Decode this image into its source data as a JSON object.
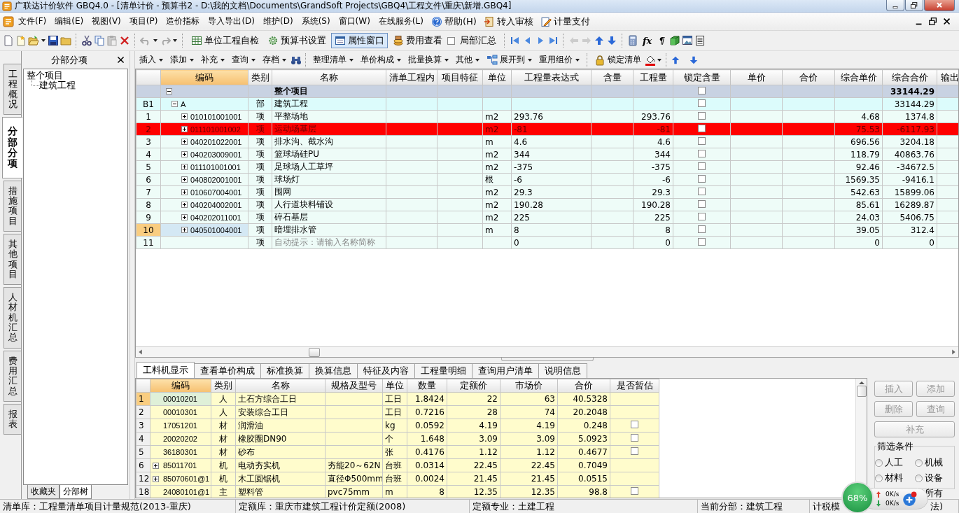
{
  "title_bar": {
    "title": "广联达计价软件 GBQ4.0 - [清单计价 - 预算书2 - D:\\我的文档\\Documents\\GrandSoft Projects\\GBQ4\\工程文件\\重庆\\新增.GBQ4]"
  },
  "menu_bar": {
    "menus": [
      "文件(F)",
      "编辑(E)",
      "视图(V)",
      "项目(P)",
      "造价指标",
      "导入导出(D)",
      "维护(D)",
      "系统(S)",
      "窗口(W)",
      "在线服务(L)"
    ],
    "menu_buttons": [
      "帮助(H)",
      "转入审核",
      "计量支付"
    ]
  },
  "toolbar": {
    "buttons": [
      {
        "label": "单位工程自检",
        "selected": false
      },
      {
        "label": "预算书设置",
        "selected": false
      },
      {
        "label": "属性窗口",
        "selected": true
      },
      {
        "label": "费用查看",
        "selected": false
      }
    ],
    "checkbox": {
      "label": "局部汇总",
      "checked": false
    },
    "glyph_buttons": [
      "fx",
      "¶"
    ]
  },
  "side_tabs": [
    {
      "label": "工程概况",
      "selected": false
    },
    {
      "label": "分部分项",
      "selected": true
    },
    {
      "label": "措施项目",
      "selected": false
    },
    {
      "label": "其他项目",
      "selected": false
    },
    {
      "label": "人材机汇总",
      "selected": false
    },
    {
      "label": "费用汇总",
      "selected": false
    },
    {
      "label": "报表",
      "selected": false
    }
  ],
  "left_panel": {
    "title": "分部分项",
    "tree": [
      {
        "label": "整个项目",
        "children": [
          {
            "label": "建筑工程"
          }
        ]
      }
    ],
    "tabs": [
      {
        "label": "收藏夹",
        "selected": false
      },
      {
        "label": "分部树",
        "selected": true
      }
    ]
  },
  "sub_toolbar": {
    "items": [
      {
        "label": "插入",
        "dropdown": true
      },
      {
        "label": "添加",
        "dropdown": true
      },
      {
        "label": "补充",
        "dropdown": true
      },
      {
        "label": "查询",
        "dropdown": true
      },
      {
        "label": "存档",
        "dropdown": true
      },
      {
        "label": "整理清单",
        "dropdown": true
      },
      {
        "label": "单价构成",
        "dropdown": true
      },
      {
        "label": "批量换算",
        "dropdown": true
      },
      {
        "label": "其他",
        "dropdown": true
      },
      {
        "label": "展开到",
        "dropdown": true
      },
      {
        "label": "重用组价",
        "dropdown": true
      },
      {
        "label": "锁定清单",
        "dropdown": false
      }
    ]
  },
  "main_table": {
    "columns": [
      {
        "label": "编码",
        "selected": true
      },
      {
        "label": "类别",
        "selected": false
      },
      {
        "label": "名称",
        "selected": false
      },
      {
        "label": "清单工程内",
        "selected": false
      },
      {
        "label": "项目特征",
        "selected": false
      },
      {
        "label": "单位",
        "selected": false
      },
      {
        "label": "工程量表达式",
        "selected": false
      },
      {
        "label": "含量",
        "selected": false
      },
      {
        "label": "工程量",
        "selected": false
      },
      {
        "label": "锁定含量",
        "selected": false
      },
      {
        "label": "单价",
        "selected": false
      },
      {
        "label": "合价",
        "selected": false
      },
      {
        "label": "综合单价",
        "selected": false
      },
      {
        "label": "综合合价",
        "selected": false
      },
      {
        "label": "输出",
        "selected": false
      }
    ],
    "rows": [
      {
        "kind": "total",
        "name": "整个项目",
        "locked": false,
        "comp_total": "33144.29",
        "expanded": true,
        "highlighted": false,
        "selected": false
      },
      {
        "kind": "division",
        "num": "B1",
        "code": "A",
        "type": "部",
        "name": "建筑工程",
        "locked": false,
        "comp_total": "33144.29",
        "expanded": true,
        "highlighted": false,
        "selected": false
      },
      {
        "kind": "item",
        "num": "1",
        "code": "010101001001",
        "type": "项",
        "name": "平整场地",
        "unit": "m2",
        "expr": "293.76",
        "qty": "293.76",
        "locked": false,
        "comp_price": "4.68",
        "comp_total": "1374.8",
        "expanded": false,
        "highlighted": false,
        "selected": false
      },
      {
        "kind": "item",
        "num": "2",
        "code": "011101001002",
        "type": "项",
        "name": "运动场基层",
        "unit": "m2",
        "expr": "-81",
        "qty": "-81",
        "locked": false,
        "comp_price": "75.53",
        "comp_total": "-6117.93",
        "expanded": false,
        "highlighted": true,
        "selected": false
      },
      {
        "kind": "item",
        "num": "3",
        "code": "040201022001",
        "type": "项",
        "name": "排水沟、截水沟",
        "unit": "m",
        "expr": "4.6",
        "qty": "4.6",
        "locked": false,
        "comp_price": "696.56",
        "comp_total": "3204.18",
        "expanded": false,
        "highlighted": false,
        "selected": false
      },
      {
        "kind": "item",
        "num": "4",
        "code": "040203009001",
        "type": "项",
        "name": "篮球场硅PU",
        "unit": "m2",
        "expr": "344",
        "qty": "344",
        "locked": false,
        "comp_price": "118.79",
        "comp_total": "40863.76",
        "expanded": false,
        "highlighted": false,
        "selected": false
      },
      {
        "kind": "item",
        "num": "5",
        "code": "011101001001",
        "type": "项",
        "name": "足球场人工草坪",
        "unit": "m2",
        "expr": "-375",
        "qty": "-375",
        "locked": false,
        "comp_price": "92.46",
        "comp_total": "-34672.5",
        "expanded": false,
        "highlighted": false,
        "selected": false
      },
      {
        "kind": "item",
        "num": "6",
        "code": "040802001001",
        "type": "项",
        "name": "球场灯",
        "unit": "根",
        "expr": "-6",
        "qty": "-6",
        "locked": false,
        "comp_price": "1569.35",
        "comp_total": "-9416.1",
        "expanded": false,
        "highlighted": false,
        "selected": false
      },
      {
        "kind": "item",
        "num": "7",
        "code": "010607004001",
        "type": "项",
        "name": "围网",
        "unit": "m2",
        "expr": "29.3",
        "qty": "29.3",
        "locked": false,
        "comp_price": "542.63",
        "comp_total": "15899.06",
        "expanded": false,
        "highlighted": false,
        "selected": false
      },
      {
        "kind": "item",
        "num": "8",
        "code": "040204002001",
        "type": "项",
        "name": "人行道块料铺设",
        "unit": "m2",
        "expr": "190.28",
        "qty": "190.28",
        "locked": false,
        "comp_price": "85.61",
        "comp_total": "16289.87",
        "expanded": false,
        "highlighted": false,
        "selected": false
      },
      {
        "kind": "item",
        "num": "9",
        "code": "040202011001",
        "type": "项",
        "name": "碎石基层",
        "unit": "m2",
        "expr": "225",
        "qty": "225",
        "locked": false,
        "comp_price": "24.03",
        "comp_total": "5406.75",
        "expanded": false,
        "highlighted": false,
        "selected": false
      },
      {
        "kind": "item",
        "num": "10",
        "code": "040501004001",
        "type": "项",
        "name": "暗埋排水管",
        "unit": "m",
        "expr": "8",
        "qty": "8",
        "locked": false,
        "comp_price": "39.05",
        "comp_total": "312.4",
        "expanded": false,
        "highlighted": false,
        "selected": true
      },
      {
        "kind": "new",
        "num": "11",
        "type": "项",
        "name": "自动提示：请输入名称简称",
        "expr": "0",
        "qty": "0",
        "locked": false,
        "comp_price": "0",
        "comp_total": "0",
        "highlighted": false,
        "selected": false
      }
    ]
  },
  "detail_tabs": [
    {
      "label": "工料机显示",
      "selected": true
    },
    {
      "label": "查看单价构成",
      "selected": false
    },
    {
      "label": "标准换算",
      "selected": false
    },
    {
      "label": "换算信息",
      "selected": false
    },
    {
      "label": "特征及内容",
      "selected": false
    },
    {
      "label": "工程量明细",
      "selected": false
    },
    {
      "label": "查询用户清单",
      "selected": false
    },
    {
      "label": "说明信息",
      "selected": false
    }
  ],
  "detail_table": {
    "columns": [
      {
        "label": "编码",
        "selected": true
      },
      {
        "label": "类别",
        "selected": false
      },
      {
        "label": "名称",
        "selected": false
      },
      {
        "label": "规格及型号",
        "selected": false
      },
      {
        "label": "单位",
        "selected": false
      },
      {
        "label": "数量",
        "selected": false
      },
      {
        "label": "定额价",
        "selected": false
      },
      {
        "label": "市场价",
        "selected": false
      },
      {
        "label": "合价",
        "selected": false
      },
      {
        "label": "是否暂估",
        "selected": false
      }
    ],
    "rows": [
      {
        "num": "1",
        "code": "00010201",
        "type": "人",
        "name": "土石方综合工日",
        "unit": "工日",
        "qty": "1.8424",
        "quota_price": "22",
        "market_price": "63",
        "total": "40.5328",
        "selected": true
      },
      {
        "num": "2",
        "code": "00010301",
        "type": "人",
        "name": "安装综合工日",
        "unit": "工日",
        "qty": "0.7216",
        "quota_price": "28",
        "market_price": "74",
        "total": "20.2048",
        "selected": false
      },
      {
        "num": "3",
        "code": "17051201",
        "type": "材",
        "name": "润滑油",
        "unit": "kg",
        "qty": "0.0592",
        "quota_price": "4.19",
        "market_price": "4.19",
        "total": "0.248",
        "estimated": false,
        "selected": false
      },
      {
        "num": "4",
        "code": "20020202",
        "type": "材",
        "name": "橡胶圈DN90",
        "unit": "个",
        "qty": "1.648",
        "quota_price": "3.09",
        "market_price": "3.09",
        "total": "5.0923",
        "estimated": false,
        "selected": false
      },
      {
        "num": "5",
        "code": "36180301",
        "type": "材",
        "name": "砂布",
        "unit": "张",
        "qty": "0.4176",
        "quota_price": "1.12",
        "market_price": "1.12",
        "total": "0.4677",
        "estimated": false,
        "selected": false
      },
      {
        "num": "6",
        "code": "85011701",
        "type": "机",
        "name": "电动夯实机",
        "spec": "夯能20～62N",
        "unit": "台班",
        "qty": "0.0314",
        "quota_price": "22.45",
        "market_price": "22.45",
        "total": "0.7049",
        "expanded": false,
        "selected": false
      },
      {
        "num": "12",
        "code": "85070601@1",
        "type": "机",
        "name": "木工圆锯机",
        "spec": "直径Φ500mm",
        "unit": "台班",
        "qty": "0.0024",
        "quota_price": "21.45",
        "market_price": "21.45",
        "total": "0.0515",
        "expanded": false,
        "selected": false
      },
      {
        "num": "18",
        "code": "24080101@1",
        "type": "主",
        "name": "塑料管",
        "spec": "pvc75mm",
        "unit": "m",
        "qty": "8",
        "quota_price": "12.35",
        "market_price": "12.35",
        "total": "98.8",
        "estimated": false,
        "selected": false
      }
    ]
  },
  "side_buttons": [
    {
      "label": "插入",
      "disabled": true
    },
    {
      "label": "添加",
      "disabled": true
    },
    {
      "label": "删除",
      "disabled": true
    },
    {
      "label": "查询",
      "disabled": true
    },
    {
      "label": "补充",
      "disabled": true
    }
  ],
  "filter": {
    "title": "筛选条件",
    "options": [
      {
        "label": "人工",
        "selected": false
      },
      {
        "label": "机械",
        "selected": false
      },
      {
        "label": "材料",
        "selected": false
      },
      {
        "label": "设备",
        "selected": false
      },
      {
        "label": "所有"
      }
    ]
  },
  "status_bar": [
    {
      "text": "清单库：工程量清单项目计量规范(2013-重庆)"
    },
    {
      "text": "定额库：重庆市建筑工程计价定额(2008)"
    },
    {
      "text": "定额专业：土建工程"
    },
    {
      "text": "当前分部：建筑工程"
    },
    {
      "text": "计税模",
      "tail": "法)"
    }
  ],
  "speed_widget": {
    "percent": "68%",
    "upload": "0K/s",
    "download": "0K/s"
  }
}
